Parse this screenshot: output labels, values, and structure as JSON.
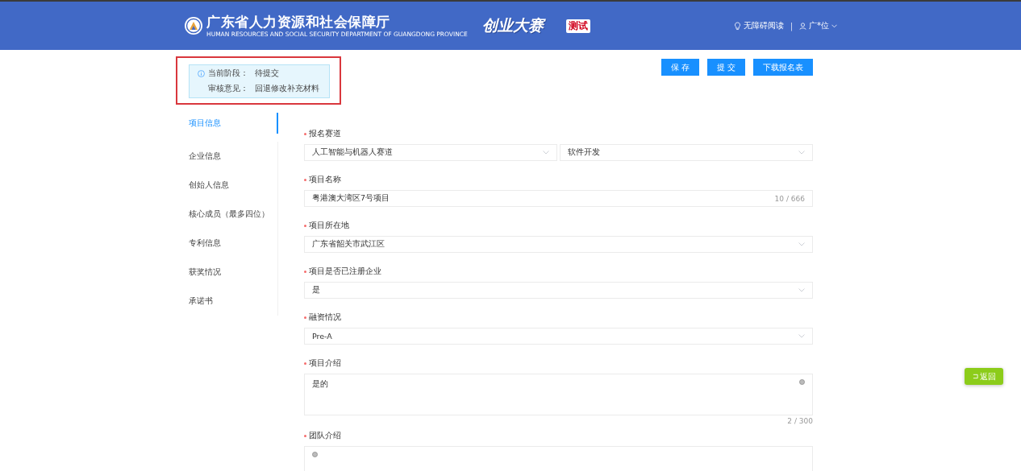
{
  "header": {
    "org_name": "广东省人力资源和社会保障厅",
    "org_subtitle": "HUMAN RESOURCES AND SOCIAL SECURITY DEPARTMENT OF GUANGDONG PROVINCE",
    "event_logo": "创业大赛",
    "env_badge": "测试",
    "accessibility_link": "无障碍阅读",
    "separator": "|",
    "user_name": "广*位"
  },
  "status": {
    "stage_label": "当前阶段：",
    "stage_value": "待提交",
    "review_label": "审核意见：",
    "review_value": "回退修改补充材料"
  },
  "actions": [
    "保 存",
    "提 交",
    "下载报名表"
  ],
  "nav": [
    {
      "label": "项目信息",
      "selected": true
    },
    {
      "label": "企业信息",
      "selected": false
    },
    {
      "label": "创始人信息",
      "selected": false
    },
    {
      "label": "核心成员（最多四位）",
      "selected": false
    },
    {
      "label": "专利信息",
      "selected": false
    },
    {
      "label": "获奖情况",
      "selected": false
    },
    {
      "label": "承诺书",
      "selected": false
    }
  ],
  "fields": [
    {
      "kind": "select-pair",
      "label": "报名赛道",
      "required": true,
      "values": [
        "人工智能与机器人赛道",
        "软件开发"
      ]
    },
    {
      "kind": "input",
      "label": "项目名称",
      "required": true,
      "value": "粤港澳大湾区7号项目",
      "counter": "10 / 666"
    },
    {
      "kind": "select",
      "label": "项目所在地",
      "required": true,
      "value": "广东省韶关市武江区"
    },
    {
      "kind": "select",
      "label": "项目是否已注册企业",
      "required": true,
      "value": "是"
    },
    {
      "kind": "select",
      "label": "融资情况",
      "required": true,
      "value": "Pre-A"
    },
    {
      "kind": "textarea",
      "label": "项目介绍",
      "required": true,
      "value": "是的",
      "counter": "2 / 300"
    },
    {
      "kind": "textarea",
      "label": "团队介绍",
      "required": true
    }
  ],
  "back_button": "返回"
}
